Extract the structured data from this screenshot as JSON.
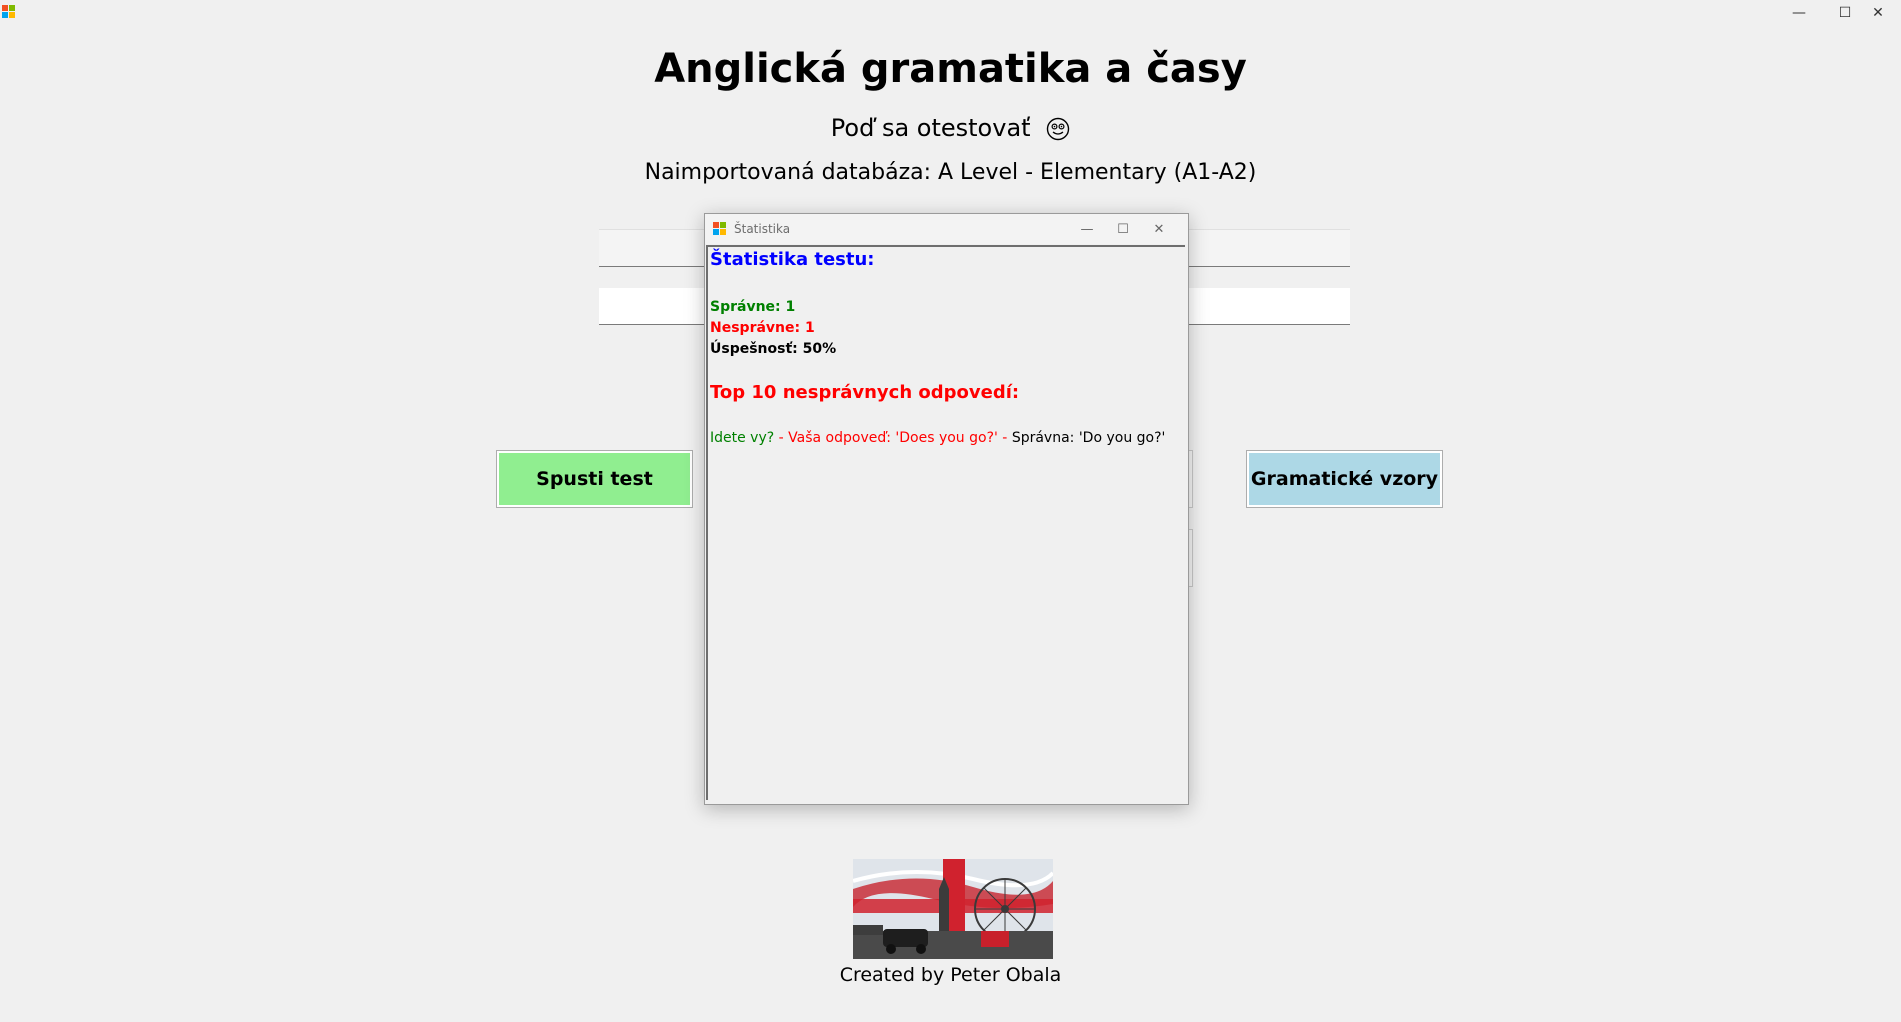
{
  "window": {
    "minimize": "—",
    "maximize": "☐",
    "close": "✕"
  },
  "main": {
    "title": "Anglická gramatika a časy",
    "subtitle": "Poď sa otestovať",
    "database_label": "Naimportovaná databáza: A Level - Elementary (A1-A2)",
    "start_button": "Spusti test",
    "grammar_button": "Gramatické vzory",
    "footer": "Created by Peter Obala"
  },
  "stats_dialog": {
    "title": "Štatistika",
    "heading": "Štatistika testu:",
    "correct": "Správne: 1",
    "incorrect": "Nesprávne: 1",
    "success": "Úspešnosť: 50%",
    "top_heading": "Top 10 nesprávnych odpovedí:",
    "answers": [
      {
        "question": "Idete vy?",
        "sep1": " - ",
        "your_answer": "Vaša odpoveď: 'Does you go?'",
        "sep2": " - ",
        "correct": "Správna: 'Do you go?'"
      }
    ]
  },
  "colors": {
    "start_button": "#90ee90",
    "grammar_button": "#add8e6",
    "heading_blue": "#0000ff",
    "correct_green": "#008000",
    "incorrect_red": "#ff0000"
  }
}
